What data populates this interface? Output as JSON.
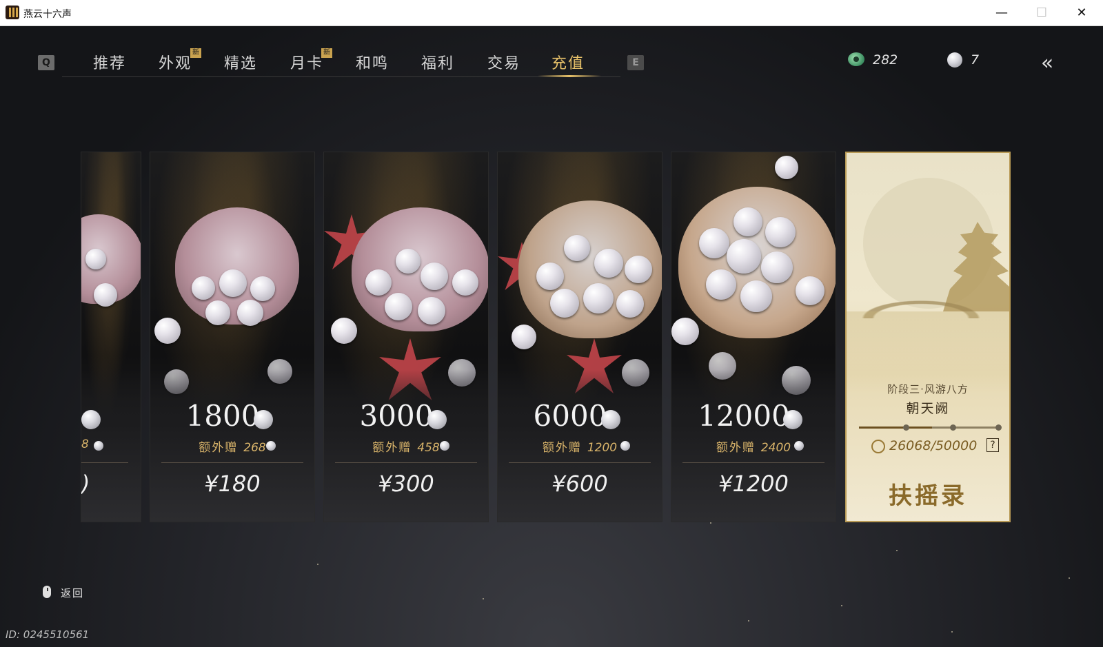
{
  "window": {
    "title": "燕云十六声",
    "minimize": "—",
    "maximize": "☐",
    "close": "✕"
  },
  "nav": {
    "key_left": "Q",
    "key_right": "E",
    "tabs": [
      {
        "label": "推荐",
        "new": false,
        "active": false
      },
      {
        "label": "外观",
        "new": true,
        "active": false
      },
      {
        "label": "精选",
        "new": false,
        "active": false
      },
      {
        "label": "月卡",
        "new": true,
        "active": false
      },
      {
        "label": "和鸣",
        "new": false,
        "active": false
      },
      {
        "label": "福利",
        "new": false,
        "active": false
      },
      {
        "label": "交易",
        "new": false,
        "active": false
      },
      {
        "label": "充值",
        "new": false,
        "active": true
      }
    ],
    "new_badge": "新"
  },
  "currency": {
    "jade": "282",
    "pearl": "7",
    "back_icon": "double-chevron-back-arrow"
  },
  "cards": [
    {
      "amount": "",
      "bonus_label": "",
      "bonus": "8",
      "price": ")",
      "partial": true
    },
    {
      "amount": "1800",
      "bonus_label": "额外赠",
      "bonus": "268",
      "price": "¥180"
    },
    {
      "amount": "3000",
      "bonus_label": "额外赠",
      "bonus": "458",
      "price": "¥300"
    },
    {
      "amount": "6000",
      "bonus_label": "额外赠",
      "bonus": "1200",
      "price": "¥600"
    },
    {
      "amount": "12000",
      "bonus_label": "额外赠",
      "bonus": "2400",
      "price": "¥1200"
    }
  ],
  "pass": {
    "stage": "阶段三·风游八方",
    "name": "朝天阙",
    "progress_text": "26068/50000",
    "progress_fraction": 0.52,
    "help": "?",
    "title": "扶摇录"
  },
  "footer": {
    "back_label": "返回",
    "player_id": "ID: 0245510561"
  },
  "colors": {
    "accent_gold": "#e8c26a",
    "bonus_gold": "#d9b46a",
    "pass_bg": "#efe7cd"
  }
}
